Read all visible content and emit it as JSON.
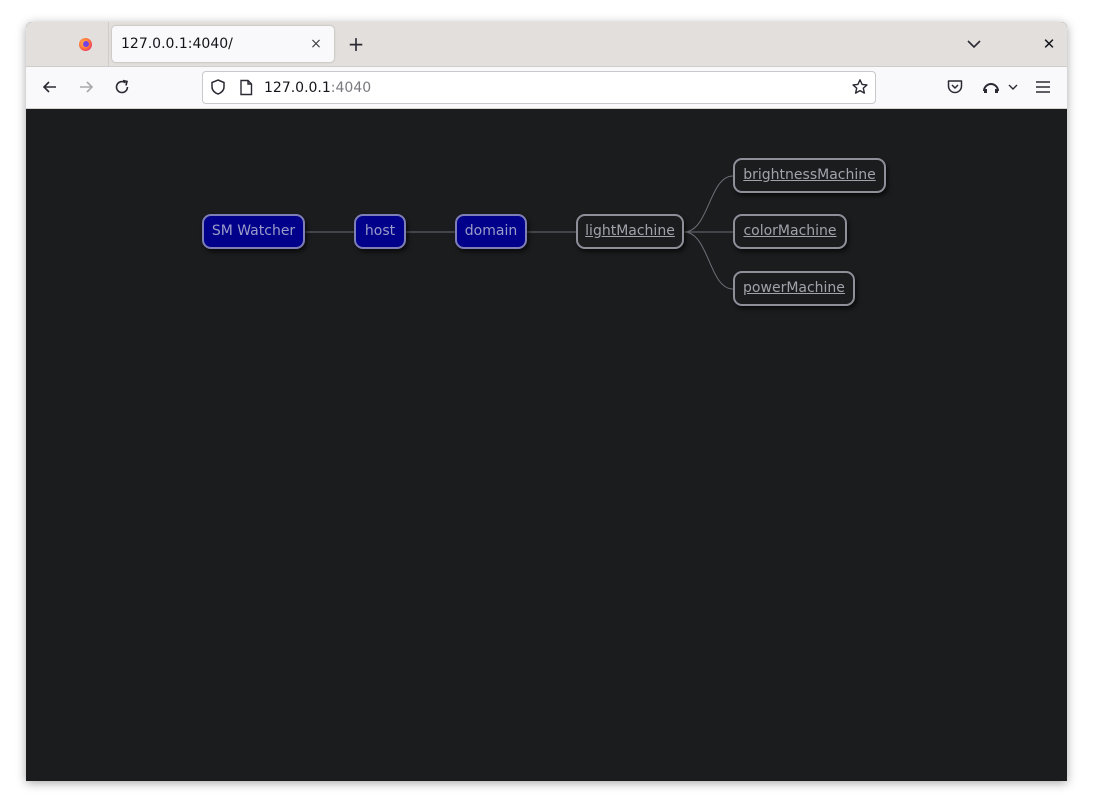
{
  "browser": {
    "tab_title": "127.0.0.1:4040/",
    "tab_close": "×",
    "new_tab": "+",
    "window_close": "✕",
    "url_host": "127.0.0.1",
    "url_port": ":4040"
  },
  "tree": {
    "nodes": [
      {
        "id": "root",
        "label": "SM Watcher",
        "style": "blue"
      },
      {
        "id": "host",
        "label": "host",
        "style": "blue"
      },
      {
        "id": "domain",
        "label": "domain",
        "style": "blue"
      },
      {
        "id": "light",
        "label": "lightMachine",
        "style": "link"
      },
      {
        "id": "brightness",
        "label": "brightnessMachine",
        "style": "link"
      },
      {
        "id": "color",
        "label": "colorMachine",
        "style": "link"
      },
      {
        "id": "power",
        "label": "powerMachine",
        "style": "link"
      }
    ]
  },
  "colors": {
    "page_background": "#1b1c1e",
    "node_blue": "#00008b",
    "edge": "#6e6e78"
  }
}
